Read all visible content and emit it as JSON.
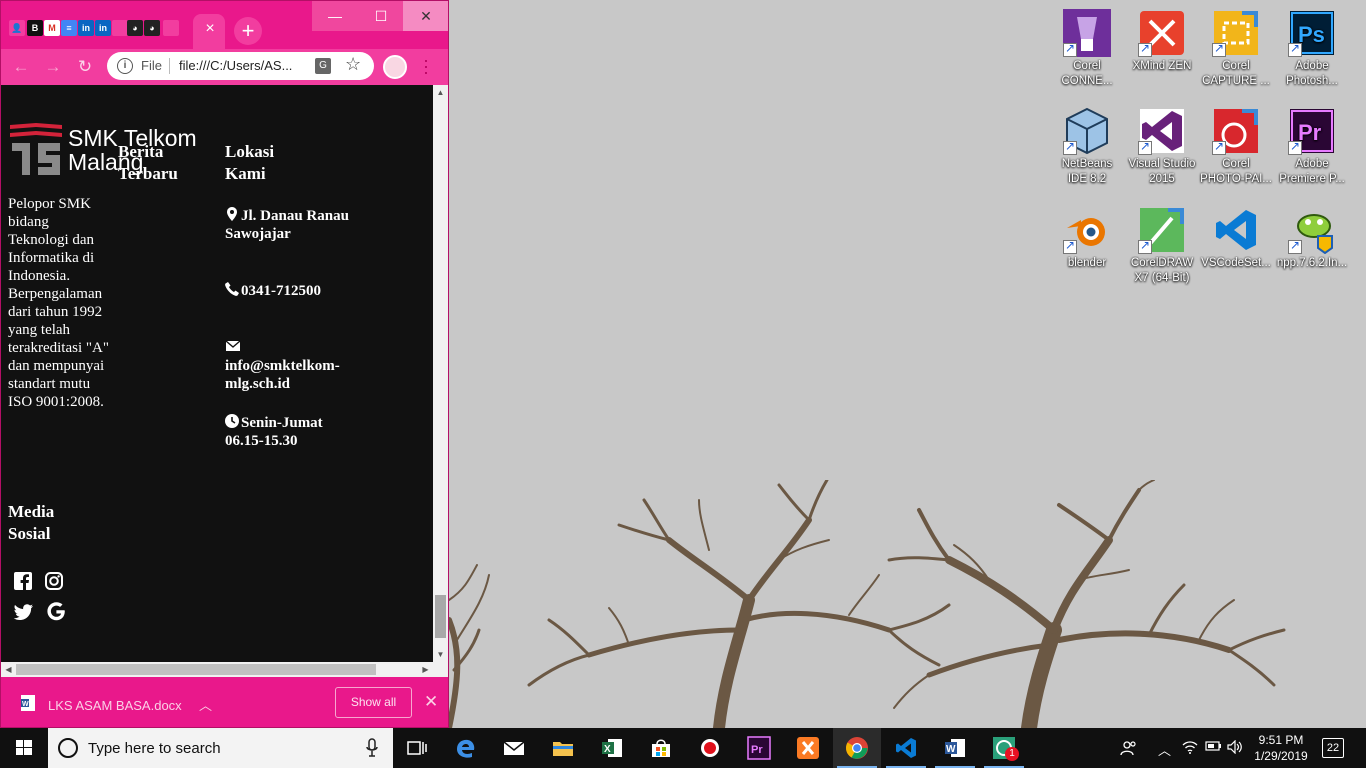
{
  "browser": {
    "tab_close_label": "×",
    "new_tab_label": "+",
    "window_controls": {
      "minimize": "—",
      "maximize": "☐",
      "close": "✕"
    },
    "url": {
      "scheme_label": "File",
      "text": "file:///C:/Users/AS..."
    },
    "favicons": [
      "person-icon",
      "b-icon",
      "gmail-icon",
      "docs-icon",
      "linkedin-icon",
      "linkedin-icon",
      "tab-icon",
      "github-icon",
      "github-icon",
      "tab-icon"
    ]
  },
  "page": {
    "logo": {
      "line1": "SMK Telkom",
      "line2": "Malang"
    },
    "berita_heading": "Berita Terbaru",
    "about_text": "Pelopor SMK bidang Teknologi dan Informatika di Indonesia. Berpengalaman dari tahun 1992 yang telah terakreditasi \"A\" dan mempunyai standart mutu ISO 9001:2008.",
    "media_heading": "Media Sosial",
    "lokasi_heading": "Lokasi Kami",
    "address": "Jl. Danau Ranau Sawojajar",
    "phone": "0341-712500",
    "email": "info@smktelkom-mlg.sch.id",
    "hours": "Senin-Jumat 06.15-15.30"
  },
  "download_bar": {
    "file_name": "LKS ASAM BASA.docx",
    "show_all_label": "Show all",
    "close_label": "✕"
  },
  "desktop_icons": [
    {
      "label": "Corel CONNE...",
      "icon": "corel-connect-icon"
    },
    {
      "label": "XMind ZEN",
      "icon": "xmind-icon"
    },
    {
      "label": "Corel CAPTURE ...",
      "icon": "corel-capture-icon"
    },
    {
      "label": "Adobe Photosh...",
      "icon": "photoshop-icon"
    },
    {
      "label": "NetBeans IDE 8.2",
      "icon": "netbeans-icon"
    },
    {
      "label": "Visual Studio 2015",
      "icon": "visual-studio-icon"
    },
    {
      "label": "Corel PHOTO-PAI...",
      "icon": "corel-photo-paint-icon"
    },
    {
      "label": "Adobe Premiere P...",
      "icon": "premiere-icon"
    },
    {
      "label": "blender",
      "icon": "blender-icon"
    },
    {
      "label": "CorelDRAW X7 (64-Bit)",
      "icon": "coreldraw-icon"
    },
    {
      "label": "VSCodeSet...",
      "icon": "vscode-setup-icon"
    },
    {
      "label": "npp.7.6.2.In...",
      "icon": "notepadpp-installer-icon"
    }
  ],
  "taskbar": {
    "search_placeholder": "Type here to search",
    "time": "9:51 PM",
    "date": "1/29/2019",
    "notification_count": "22",
    "whatsapp_badge": "1"
  },
  "colors": {
    "chrome_pink": "#e9188b",
    "page_bg": "#111111",
    "desktop_bg": "#c8c8c8",
    "tree_color": "#6b5844"
  }
}
